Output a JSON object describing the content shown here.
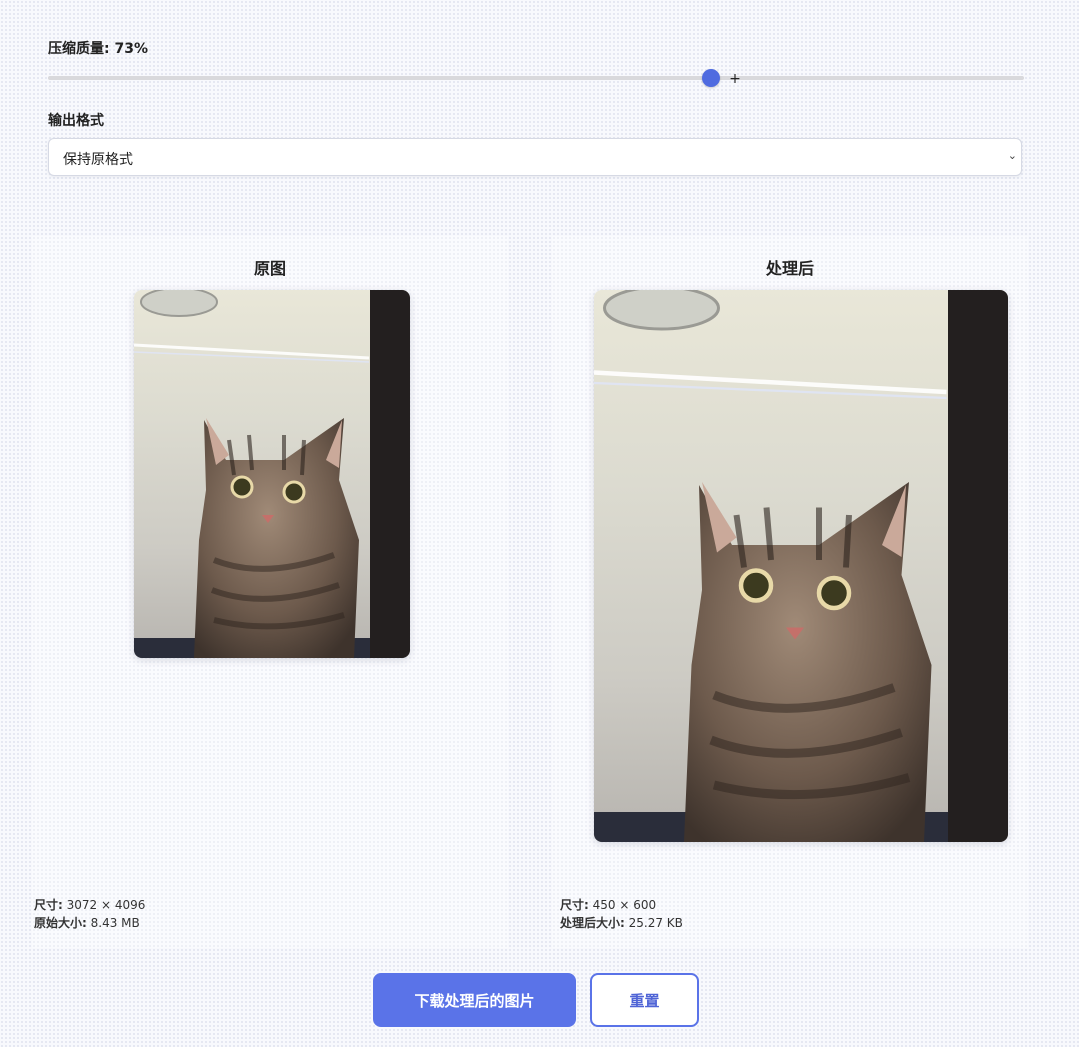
{
  "quality": {
    "label_prefix": "压缩质量: ",
    "value_percent": 73,
    "label": "压缩质量: 73%"
  },
  "format": {
    "label": "输出格式",
    "selected": "保持原格式"
  },
  "original": {
    "title": "原图",
    "dimensions_label": "尺寸:",
    "dimensions_value": "3072 × 4096",
    "size_label": "原始大小:",
    "size_value": "8.43 MB"
  },
  "processed": {
    "title": "处理后",
    "dimensions_label": "尺寸:",
    "dimensions_value": "450 × 600",
    "size_label": "处理后大小:",
    "size_value": "25.27 KB"
  },
  "actions": {
    "download_label": "下载处理后的图片",
    "reset_label": "重置"
  },
  "colors": {
    "accent": "#5a73e8",
    "background": "#f8f9fd"
  },
  "icons": {
    "select_chevron": "chevron-down-icon",
    "cursor": "crosshair-cursor-icon"
  }
}
